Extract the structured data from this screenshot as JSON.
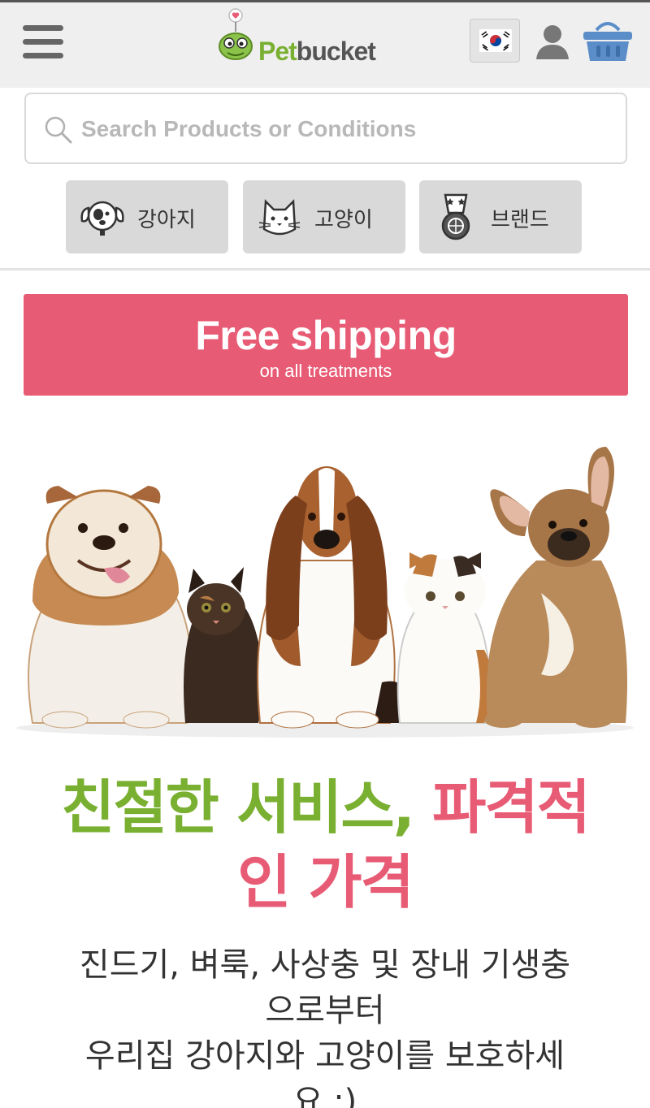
{
  "header": {
    "menu_icon": "hamburger-menu-icon",
    "logo": {
      "text_pet": "Pet",
      "text_bucket": "bucket",
      "brand_color": "#7ab031"
    },
    "language_flag": "korea-flag-icon",
    "account_icon": "user-icon",
    "cart_icon": "basket-icon"
  },
  "search": {
    "placeholder": "Search Products or Conditions",
    "value": ""
  },
  "categories": [
    {
      "label": "강아지",
      "icon": "dog-icon"
    },
    {
      "label": "고양이",
      "icon": "cat-icon"
    },
    {
      "label": "브랜드",
      "icon": "medal-icon"
    }
  ],
  "promo": {
    "title": "Free shipping",
    "subtitle": "on all treatments",
    "color": "#e85b75"
  },
  "headline": {
    "part1": "친절한 서비스,",
    "part2_line1": "파격적",
    "part2_line2": "인 가격",
    "green": "#7ab031",
    "pink": "#e85b75"
  },
  "body": {
    "line1": "진드기, 벼룩, 사상충 및 장내 기생충",
    "line2": "으로부터",
    "line3": "우리집 강아지와 고양이를 보호하세",
    "line4": "요 :)"
  }
}
